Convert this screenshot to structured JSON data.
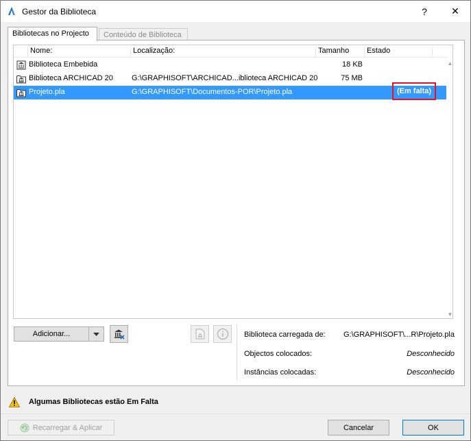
{
  "window": {
    "title": "Gestor da Biblioteca",
    "help_label": "?",
    "close_label": "✕"
  },
  "tabs": [
    {
      "label": "Bibliotecas no Projecto",
      "active": true
    },
    {
      "label": "Conteúdo de Biblioteca",
      "active": false
    }
  ],
  "list": {
    "columns": [
      "Nome:",
      "Localização:",
      "Tamanho",
      "Estado"
    ],
    "rows": [
      {
        "name": "Biblioteca Embebida",
        "location": "",
        "size": "18 KB",
        "status": "",
        "icon": "embedded-library-icon"
      },
      {
        "name": "Biblioteca ARCHICAD 20",
        "location": "G:\\GRAPHISOFT\\ARCHICAD...iblioteca ARCHICAD 20",
        "size": "75 MB",
        "status": "",
        "icon": "library-folder-icon"
      },
      {
        "name": "Projeto.pla",
        "location": "G:\\GRAPHISOFT\\Documentos-POR\\Projeto.pla",
        "size": "",
        "status": "(Em falta)",
        "icon": "library-folder-icon",
        "selected": true
      }
    ]
  },
  "buttons": {
    "add_label": "Adicionar...",
    "reload_label": "Recarregar & Aplicar",
    "cancel_label": "Cancelar",
    "ok_label": "OK"
  },
  "info": {
    "loaded_label": "Biblioteca carregada de:",
    "loaded_value": "G:\\GRAPHISOFT\\...R\\Projeto.pla",
    "objects_label": "Objectos colocados:",
    "objects_value": "Desconhecido",
    "instances_label": "Instâncias colocadas:",
    "instances_value": "Desconhecido"
  },
  "warning": {
    "text": "Algumas Bibliotecas estão Em Falta"
  },
  "colors": {
    "selection": "#3399ff",
    "highlight_box": "#e81123",
    "warning": "#f5c211"
  }
}
